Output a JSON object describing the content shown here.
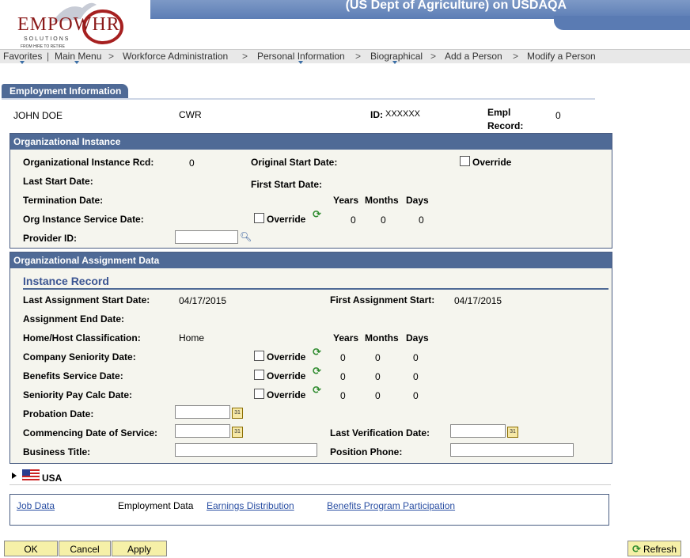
{
  "header": {
    "title": "(US Dept of Agriculture) on USDAQA",
    "logo_main": "EMPOWHR",
    "logo_sub": "SOLUTIONS",
    "logo_tag": "FROM HIRE TO RETIRE"
  },
  "nav": {
    "items": [
      "Favorites",
      "Main Menu",
      "Workforce Administration",
      "Personal Information",
      "Biographical",
      "Add a Person",
      "Modify a Person"
    ],
    "separator": ">"
  },
  "tab": {
    "label": "Employment Information"
  },
  "person": {
    "name": "JOHN DOE",
    "type": "CWR",
    "id_label": "ID:",
    "id_value": "XXXXXX",
    "empl_record_label_1": "Empl",
    "empl_record_label_2": "Record:",
    "empl_record_value": "0"
  },
  "org_instance": {
    "heading": "Organizational Instance",
    "instance_rcd_label": "Organizational Instance Rcd:",
    "instance_rcd_value": "0",
    "original_start_label": "Original Start Date:",
    "override_label": "Override",
    "last_start_label": "Last Start Date:",
    "first_start_label": "First Start Date:",
    "termination_label": "Termination Date:",
    "years_label": "Years",
    "months_label": "Months",
    "days_label": "Days",
    "service_date_label": "Org Instance Service Date:",
    "service_years": "0",
    "service_months": "0",
    "service_days": "0",
    "provider_label": "Provider ID:",
    "provider_value": ""
  },
  "org_assignment": {
    "heading": "Organizational Assignment Data",
    "instance_record_title": "Instance Record",
    "last_assign_start_label": "Last Assignment Start Date:",
    "last_assign_start_value": "04/17/2015",
    "first_assign_start_label": "First Assignment Start:",
    "first_assign_start_value": "04/17/2015",
    "assign_end_label": "Assignment End Date:",
    "home_host_label": "Home/Host Classification:",
    "home_host_value": "Home",
    "years_label": "Years",
    "months_label": "Months",
    "days_label": "Days",
    "override_label": "Override",
    "rows": [
      {
        "label": "Company Seniority Date:",
        "years": "0",
        "months": "0",
        "days": "0"
      },
      {
        "label": "Benefits Service Date:",
        "years": "0",
        "months": "0",
        "days": "0"
      },
      {
        "label": "Seniority Pay Calc Date:",
        "years": "0",
        "months": "0",
        "days": "0"
      }
    ],
    "probation_label": "Probation Date:",
    "commencing_label": "Commencing Date of Service:",
    "last_verification_label": "Last Verification Date:",
    "business_title_label": "Business Title:",
    "position_phone_label": "Position Phone:",
    "calendar_glyph": "31"
  },
  "country": {
    "label": "USA"
  },
  "links": {
    "job_data": "Job Data",
    "employment_data": "Employment Data",
    "earnings_distribution": "Earnings Distribution",
    "benefits_program": "Benefits Program Participation"
  },
  "buttons": {
    "ok": "OK",
    "cancel": "Cancel",
    "apply": "Apply",
    "refresh": "Refresh"
  },
  "icons": {
    "refresh": "refresh-icon",
    "lookup": "magnifier-icon",
    "calendar": "calendar-icon",
    "flag": "us-flag-icon"
  },
  "colors": {
    "header_blue": "#5c7db5",
    "group_header": "#4f6a96",
    "button_bg": "#f6f0a8",
    "link": "#2a4fa3"
  }
}
